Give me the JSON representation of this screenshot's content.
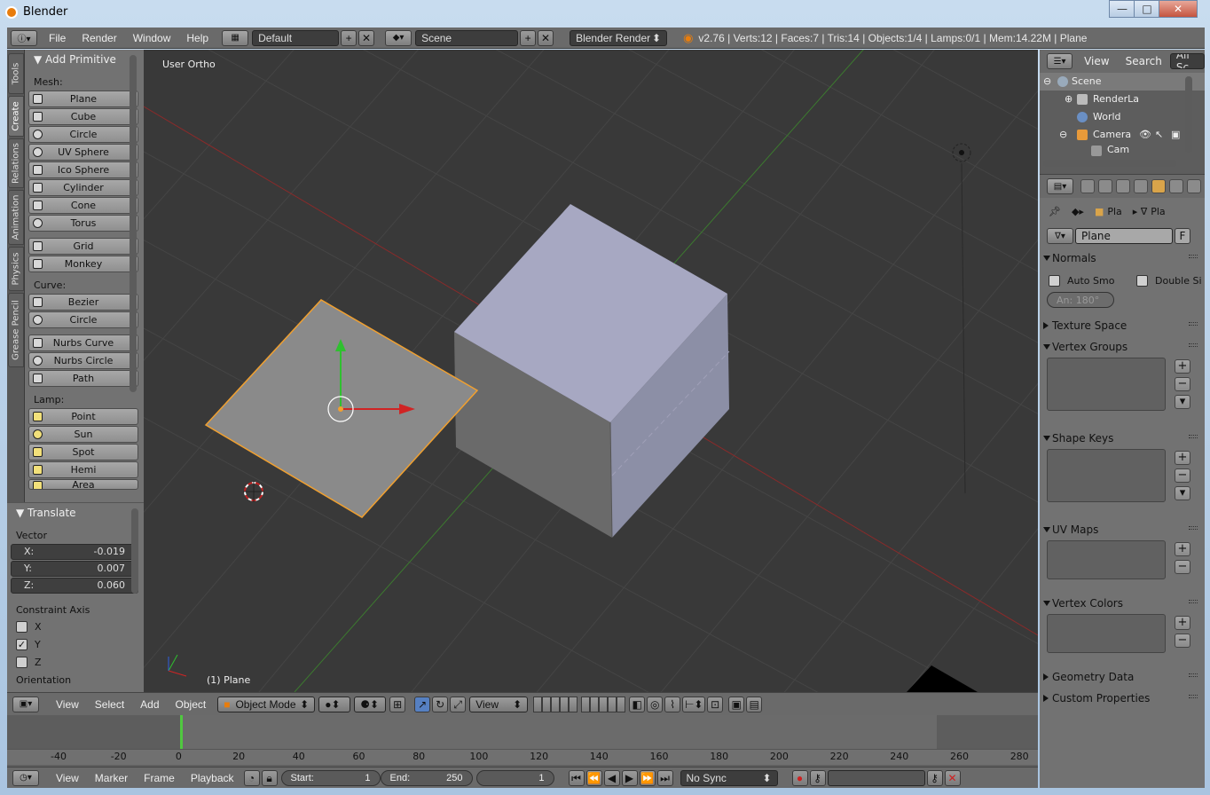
{
  "window": {
    "title": "Blender"
  },
  "info_header": {
    "menus": [
      "File",
      "Render",
      "Window",
      "Help"
    ],
    "screen_layout": "Default",
    "scene": "Scene",
    "render_engine": "Blender Render",
    "stats": "v2.76 | Verts:12 | Faces:7 | Tris:14 | Objects:1/4 | Lamps:0/1 | Mem:14.22M | Plane"
  },
  "tool_tabs": [
    "Tools",
    "Create",
    "Relations",
    "Animation",
    "Physics",
    "Grease Pencil"
  ],
  "add_primitive": {
    "title": "Add Primitive",
    "mesh_label": "Mesh:",
    "mesh": [
      "Plane",
      "Cube",
      "Circle",
      "UV Sphere",
      "Ico Sphere",
      "Cylinder",
      "Cone",
      "Torus"
    ],
    "mesh2": [
      "Grid",
      "Monkey"
    ],
    "curve_label": "Curve:",
    "curve": [
      "Bezier",
      "Circle"
    ],
    "curve2": [
      "Nurbs Curve",
      "Nurbs Circle",
      "Path"
    ],
    "lamp_label": "Lamp:",
    "lamp": [
      "Point",
      "Sun",
      "Spot",
      "Hemi",
      "Area"
    ]
  },
  "translate": {
    "title": "Translate",
    "vector_label": "Vector",
    "x_label": "X:",
    "x": "-0.019",
    "y_label": "Y:",
    "y": "0.007",
    "z_label": "Z:",
    "z": "0.060",
    "constraint_label": "Constraint Axis",
    "axes": [
      {
        "name": "X",
        "checked": false
      },
      {
        "name": "Y",
        "checked": true
      },
      {
        "name": "Z",
        "checked": false
      }
    ],
    "orientation_label": "Orientation"
  },
  "viewport": {
    "view_name": "User Ortho",
    "object_label": "(1) Plane"
  },
  "viewport_header": {
    "menus": [
      "View",
      "Select",
      "Add",
      "Object"
    ],
    "mode": "Object Mode",
    "orientation": "View"
  },
  "timeline": {
    "ticks": [
      "-40",
      "-20",
      "0",
      "20",
      "40",
      "60",
      "80",
      "100",
      "120",
      "140",
      "160",
      "180",
      "200",
      "220",
      "240",
      "260",
      "280"
    ],
    "menus": [
      "View",
      "Marker",
      "Frame",
      "Playback"
    ],
    "start_label": "Start:",
    "start": "1",
    "end_label": "End:",
    "end": "250",
    "current": "1",
    "sync": "No Sync"
  },
  "outliner": {
    "menus": [
      "View",
      "Search"
    ],
    "filter": "All Sc",
    "items": [
      "Scene",
      "RenderLa",
      "World",
      "Camera",
      "Cam"
    ]
  },
  "properties": {
    "breadcrumb": [
      "Pla",
      "Pla"
    ],
    "datablock": "Plane",
    "fake_user": "F",
    "normals": {
      "title": "Normals",
      "auto_smooth": "Auto Smo",
      "double_sided": "Double Si",
      "angle": "An: 180°"
    },
    "panels": {
      "texture_space": "Texture Space",
      "vertex_groups": "Vertex Groups",
      "shape_keys": "Shape Keys",
      "uv_maps": "UV Maps",
      "vertex_colors": "Vertex Colors",
      "geometry_data": "Geometry Data",
      "custom_properties": "Custom Properties"
    }
  },
  "colors": {
    "accent": "#e87d0d",
    "selection": "#f0a030",
    "frame_cursor": "#50c840"
  }
}
